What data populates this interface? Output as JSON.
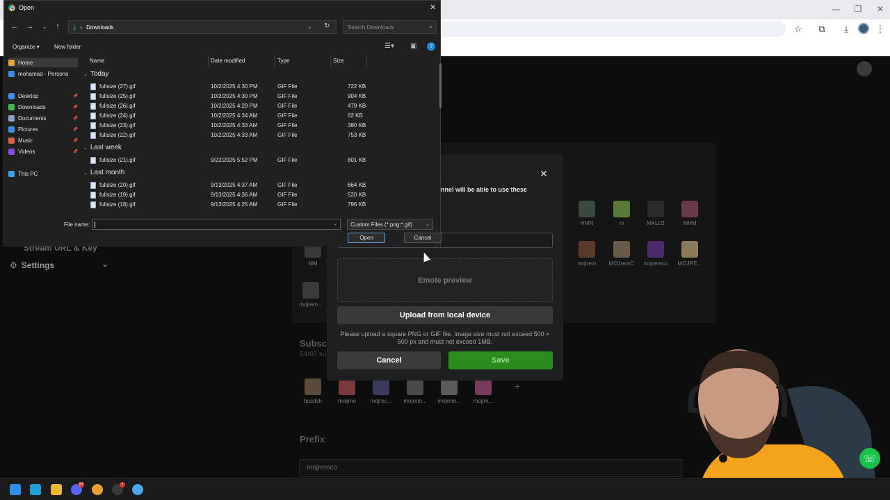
{
  "page": {
    "side_links": [
      "Stream URL & Key",
      "Settings"
    ],
    "emotes_row1": [
      {
        "label": "HMN",
        "color": "#3a4a3a"
      },
      {
        "label": "m",
        "color": "#5a7a3a"
      },
      {
        "label": "MALIZI",
        "color": "#2a2a2a"
      },
      {
        "label": "MHM",
        "color": "#6a3a4a"
      }
    ],
    "emotes_row2": [
      {
        "label": "MM",
        "color": "#3a3a3a"
      },
      {
        "label": "mojrem",
        "color": "#5a3a2a"
      },
      {
        "label": "MOJremC",
        "color": "#6a5a4a"
      },
      {
        "label": "mojremco",
        "color": "#4a2a6a"
      },
      {
        "label": "MOJRE...",
        "color": "#8a7a5a"
      }
    ],
    "emotes_row3": [
      {
        "label": "mojrem...",
        "color": "#3a3a3a"
      }
    ],
    "subscriber_section": {
      "heading": "Subsc",
      "sub": "54/60 su"
    },
    "sub_emotes": [
      {
        "label": "husdsh",
        "color": "#5a4a3a"
      },
      {
        "label": "mojjmo",
        "color": "#7a3a3a"
      },
      {
        "label": "mojrec...",
        "color": "#3a3a5a"
      },
      {
        "label": "mojrem...",
        "color": "#4a4a4a"
      },
      {
        "label": "mojrem...",
        "color": "#5a5a5a"
      },
      {
        "label": "mojjre...",
        "color": "#7a3a5a"
      }
    ],
    "prefix_heading": "Prefix",
    "prefix_value": "mojremco"
  },
  "modal": {
    "description": "nnel will be able to use these",
    "preview_label": "Emote preview",
    "upload_label": "Upload from local device",
    "hint": "Please upload a square PNG or GIF file. Image size must not exceed 500 × 500 px and must not exceed 1MB.",
    "cancel_label": "Cancel",
    "save_label": "Save",
    "close_glyph": "✕"
  },
  "dialog": {
    "title": "Open",
    "address": "Downloads",
    "search_placeholder": "Search Downloads",
    "organize_label": "Organize ▾",
    "new_folder_label": "New folder",
    "nav_items": [
      {
        "label": "Home",
        "color": "#e8a33a",
        "pinned": false
      },
      {
        "label": "mohamad - Persona",
        "color": "#3a8ee8",
        "pinned": false
      },
      {
        "label": "Desktop",
        "color": "#3a8ee8",
        "pinned": true
      },
      {
        "label": "Downloads",
        "color": "#3fb950",
        "pinned": true
      },
      {
        "label": "Documents",
        "color": "#8aa3c8",
        "pinned": true
      },
      {
        "label": "Pictures",
        "color": "#3a8ee8",
        "pinned": true
      },
      {
        "label": "Music",
        "color": "#e05a4a",
        "pinned": true
      },
      {
        "label": "Videos",
        "color": "#8a4ae0",
        "pinned": true
      },
      {
        "label": "This PC",
        "color": "#3a9ee8",
        "pinned": false
      }
    ],
    "columns": {
      "name": "Name",
      "date": "Date modified",
      "type": "Type",
      "size": "Size"
    },
    "groups": [
      {
        "label": "Today",
        "files": [
          {
            "name": "fullsize (27).gif",
            "date": "10/2/2025 4:30 PM",
            "type": "GIF File",
            "size": "722 KB"
          },
          {
            "name": "fullsize (25).gif",
            "date": "10/2/2025 4:30 PM",
            "type": "GIF File",
            "size": "904 KB"
          },
          {
            "name": "fullsize (26).gif",
            "date": "10/2/2025 4:29 PM",
            "type": "GIF File",
            "size": "479 KB"
          },
          {
            "name": "fullsize (24).gif",
            "date": "10/2/2025 4:34 AM",
            "type": "GIF File",
            "size": "62 KB"
          },
          {
            "name": "fullsize (23).gif",
            "date": "10/2/2025 4:33 AM",
            "type": "GIF File",
            "size": "380 KB"
          },
          {
            "name": "fullsize (22).gif",
            "date": "10/2/2025 4:33 AM",
            "type": "GIF File",
            "size": "753 KB"
          }
        ]
      },
      {
        "label": "Last week",
        "files": [
          {
            "name": "fullsize (21).gif",
            "date": "9/22/2025 5:52 PM",
            "type": "GIF File",
            "size": "801 KB"
          }
        ]
      },
      {
        "label": "Last month",
        "files": [
          {
            "name": "fullsize (20).gif",
            "date": "9/13/2025 4:37 AM",
            "type": "GIF File",
            "size": "664 KB"
          },
          {
            "name": "fullsize (19).gif",
            "date": "9/13/2025 4:36 AM",
            "type": "GIF File",
            "size": "520 KB"
          },
          {
            "name": "fullsize (18).gif",
            "date": "9/13/2025 4:25 AM",
            "type": "GIF File",
            "size": "796 KB"
          }
        ]
      }
    ],
    "file_name_label": "File name:",
    "file_name_value": "",
    "filter_label": "Custom Files (*.png;*.gif)",
    "open_label": "Open",
    "cancel_label": "Cancel"
  },
  "taskbar": {
    "apps": [
      {
        "name": "start",
        "color": "#2f8fe8"
      },
      {
        "name": "edge",
        "color": "#1f9fd8"
      },
      {
        "name": "file-explorer",
        "color": "#e8b830"
      },
      {
        "name": "discord",
        "color": "#5865f2",
        "badge": "9+"
      },
      {
        "name": "chrome",
        "color": "#e8a030"
      },
      {
        "name": "obs",
        "color": "#3a3a3a",
        "badge": "•"
      },
      {
        "name": "app",
        "color": "#4aa8e8"
      }
    ]
  },
  "colors": {
    "save_green": "#2c8b1f",
    "accent_blue": "#1e88e5",
    "fab_green": "#18c24a"
  }
}
